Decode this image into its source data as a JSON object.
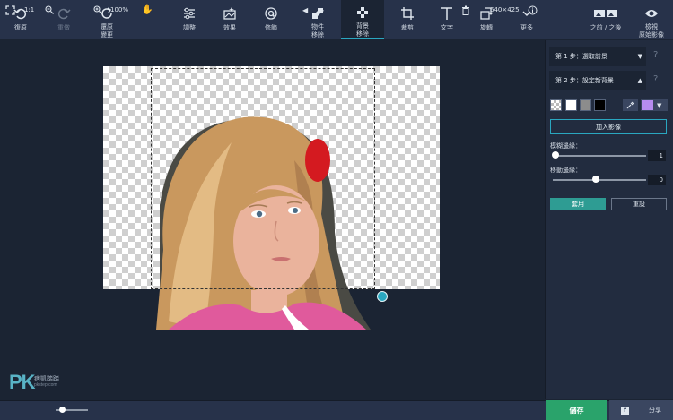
{
  "toolbar": {
    "undo": "復原",
    "redo": "重做",
    "restore": "還原\n變更",
    "adjust": "調整",
    "effects": "效果",
    "decorate": "修飾",
    "object_remove": "物件\n移除",
    "bg_remove": "背景\n移除",
    "crop": "裁剪",
    "text": "文字",
    "rotate": "旋轉",
    "more": "更多",
    "before_after": "之前 / 之後",
    "view_original": "檢視\n原始影像"
  },
  "panel": {
    "step1": "第 1 步：選取前景",
    "step2": "第 2 步：設定新背景",
    "help": "?",
    "swatch_colors": [
      "#ffffff",
      "#8c8c8c",
      "#000000"
    ],
    "selected_color": "#b68cf0",
    "add_image": "加入影像",
    "blur_edges_label": "模糊邊緣：",
    "blur_edges_value": "1",
    "move_edges_label": "移動邊緣：",
    "move_edges_value": "0",
    "apply": "套用",
    "reset": "重設"
  },
  "bottom": {
    "ratio": "1:1",
    "zoom": "100%",
    "dimensions": "640×425",
    "save": "儲存",
    "share": "分享"
  },
  "watermark": {
    "logo": "PK",
    "name": "痞凱踏踏",
    "site": "pkstep.com"
  },
  "colors": {
    "accent": "#2aa7c0",
    "save": "#2aa36b",
    "apply": "#2e9c93"
  }
}
